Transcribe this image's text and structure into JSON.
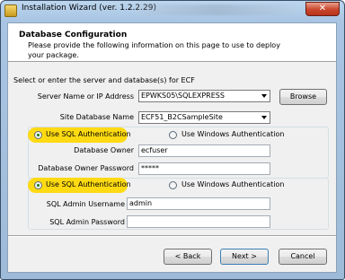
{
  "window": {
    "title": "Installation Wizard (ver. 1.2.2.29)",
    "close_glyph": "✕"
  },
  "header": {
    "title": "Database Configuration",
    "subtitle": "Please provide the following information on this page to use to deploy your package."
  },
  "intro_text": "Select or enter the server and database(s) for ECF",
  "server": {
    "label": "Server Name or IP Address",
    "value": "EPWKS05\\SQLEXPRESS",
    "browse_label": "Browse"
  },
  "site_db": {
    "label": "Site Database Name",
    "value": "ECF51_B2CSampleSite"
  },
  "auth1": {
    "sql_label": "Use SQL Authentication",
    "windows_label": "Use Windows Authentication",
    "selected": "sql"
  },
  "db_owner": {
    "label": "Database Owner",
    "value": "ecfuser"
  },
  "db_owner_password": {
    "label": "Database Owner Password",
    "value": "*****"
  },
  "auth2": {
    "sql_label": "Use SQL Authentication",
    "windows_label": "Use Windows Authentication",
    "selected": "sql"
  },
  "admin_user": {
    "label": "SQL Admin Username",
    "value": "admin"
  },
  "admin_password": {
    "label": "SQL Admin Password",
    "value": ""
  },
  "buttons": {
    "back": "< Back",
    "next": "Next >",
    "cancel": "Cancel"
  },
  "colors": {
    "highlight": "#ffd800",
    "titlebar": "#a9c5e3"
  }
}
